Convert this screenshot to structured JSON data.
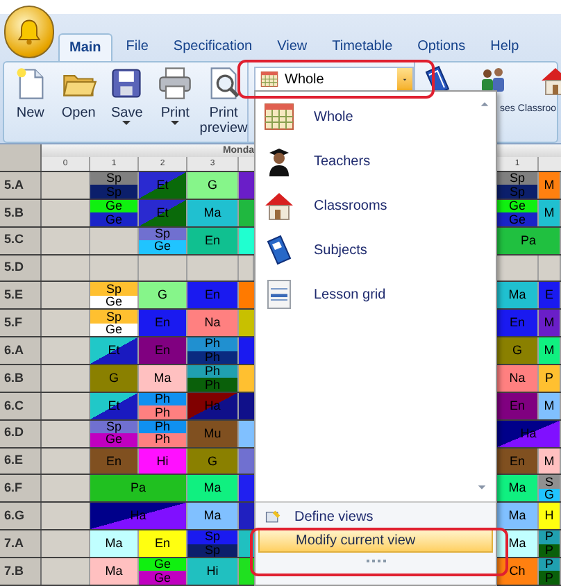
{
  "tabs": [
    {
      "label": "Main",
      "selected": true
    },
    {
      "label": "File",
      "selected": false
    },
    {
      "label": "Specification",
      "selected": false
    },
    {
      "label": "View",
      "selected": false
    },
    {
      "label": "Timetable",
      "selected": false
    },
    {
      "label": "Options",
      "selected": false
    },
    {
      "label": "Help",
      "selected": false
    }
  ],
  "ribbon": {
    "buttons": [
      {
        "label": "New",
        "dropdown": false
      },
      {
        "label": "Open",
        "dropdown": false
      },
      {
        "label": "Save",
        "dropdown": true
      },
      {
        "label": "Print",
        "dropdown": true
      },
      {
        "label": "Print preview",
        "dropdown": false
      }
    ],
    "view_combo": {
      "value": "Whole"
    },
    "partial_labels": [
      "ses",
      "Classroo"
    ]
  },
  "timetable": {
    "day": "Monda",
    "periods": [
      "0",
      "1",
      "2",
      "3"
    ],
    "right_periods": [
      "1"
    ],
    "rows": [
      {
        "class": "5.A",
        "cells": [
          {
            "kind": "split",
            "parts": [
              {
                "text": "Sp",
                "color": "#808080"
              },
              {
                "text": "Sp",
                "color": "#0c1f6b"
              }
            ]
          },
          {
            "kind": "diagonal",
            "parts": [
              {
                "text": "Et",
                "color": "#2a2ad0"
              },
              {
                "color": "#0a6a0a"
              }
            ]
          },
          {
            "kind": "single",
            "parts": [
              {
                "text": "G",
                "color": "#86f58a"
              }
            ]
          },
          {
            "kind": "strip",
            "parts": [
              {
                "color": "#6a1ec8"
              }
            ]
          }
        ],
        "right": [
          {
            "kind": "split",
            "parts": [
              {
                "text": "Sp",
                "color": "#808080"
              },
              {
                "text": "Sp",
                "color": "#0c1f6b"
              }
            ]
          },
          {
            "kind": "single",
            "parts": [
              {
                "text": "M",
                "color": "#ff8010"
              }
            ]
          }
        ]
      },
      {
        "class": "5.B",
        "cells": [
          {
            "kind": "split",
            "parts": [
              {
                "text": "Ge",
                "color": "#10f010"
              },
              {
                "text": "Ge",
                "color": "#1a24c8"
              }
            ]
          },
          {
            "kind": "diagonal",
            "parts": [
              {
                "text": "Et",
                "color": "#2a2ad0"
              },
              {
                "color": "#0a6a0a"
              }
            ]
          },
          {
            "kind": "single",
            "parts": [
              {
                "text": "Ma",
                "color": "#20c0d0"
              }
            ]
          },
          {
            "kind": "strip",
            "parts": [
              {
                "color": "#20b840"
              }
            ]
          }
        ],
        "right": [
          {
            "kind": "split",
            "parts": [
              {
                "text": "Ge",
                "color": "#10f010"
              },
              {
                "text": "Ge",
                "color": "#1a24c8"
              }
            ]
          },
          {
            "kind": "single",
            "parts": [
              {
                "text": "M",
                "color": "#20c0d0"
              }
            ]
          }
        ]
      },
      {
        "class": "5.C",
        "cells": [
          {
            "kind": "empty"
          },
          {
            "kind": "split",
            "parts": [
              {
                "text": "Sp",
                "color": "#7070d0"
              },
              {
                "text": "Ge",
                "color": "#20c4ff"
              }
            ]
          },
          {
            "kind": "single",
            "parts": [
              {
                "text": "En",
                "color": "#10c090"
              }
            ]
          },
          {
            "kind": "strip",
            "parts": [
              {
                "color": "#20ffd0"
              }
            ]
          }
        ],
        "right": [
          {
            "kind": "wide",
            "parts": [
              {
                "text": "Pa",
                "color": "#20c040"
              }
            ]
          }
        ]
      },
      {
        "class": "5.D",
        "cells": [
          {
            "kind": "empty"
          },
          {
            "kind": "empty"
          },
          {
            "kind": "empty"
          },
          {
            "kind": "strip-empty"
          }
        ],
        "right": [
          {
            "kind": "empty"
          },
          {
            "kind": "empty-narrow"
          }
        ]
      },
      {
        "class": "5.E",
        "cells": [
          {
            "kind": "split",
            "parts": [
              {
                "text": "Sp",
                "color": "#ffc030"
              },
              {
                "text": "Ge",
                "color": "#ffffff"
              }
            ]
          },
          {
            "kind": "single",
            "parts": [
              {
                "text": "G",
                "color": "#86f58a"
              }
            ]
          },
          {
            "kind": "single",
            "parts": [
              {
                "text": "En",
                "color": "#1a1af0"
              }
            ]
          },
          {
            "kind": "strip",
            "parts": [
              {
                "color": "#ff7a00"
              }
            ]
          }
        ],
        "right": [
          {
            "kind": "single",
            "parts": [
              {
                "text": "Ma",
                "color": "#20c0d0"
              }
            ]
          },
          {
            "kind": "single",
            "parts": [
              {
                "text": "E",
                "color": "#1a1af0"
              }
            ]
          }
        ]
      },
      {
        "class": "5.F",
        "cells": [
          {
            "kind": "split",
            "parts": [
              {
                "text": "Sp",
                "color": "#ffc030"
              },
              {
                "text": "Ge",
                "color": "#ffffff"
              }
            ]
          },
          {
            "kind": "single",
            "parts": [
              {
                "text": "En",
                "color": "#1a1af0"
              }
            ]
          },
          {
            "kind": "single",
            "parts": [
              {
                "text": "Na",
                "color": "#ff8080"
              }
            ]
          },
          {
            "kind": "strip",
            "parts": [
              {
                "color": "#c8c000"
              }
            ]
          }
        ],
        "right": [
          {
            "kind": "single",
            "parts": [
              {
                "text": "En",
                "color": "#1a1af0"
              }
            ]
          },
          {
            "kind": "single",
            "parts": [
              {
                "text": "M",
                "color": "#6a1ec8"
              }
            ]
          }
        ]
      },
      {
        "class": "6.A",
        "cells": [
          {
            "kind": "diagonal",
            "parts": [
              {
                "text": "Et",
                "color": "#20c8c8"
              },
              {
                "color": "#1a1ac0"
              }
            ]
          },
          {
            "kind": "single",
            "parts": [
              {
                "text": "En",
                "color": "#800080"
              }
            ]
          },
          {
            "kind": "split",
            "parts": [
              {
                "text": "Ph",
                "color": "#2090d0"
              },
              {
                "text": "Ph",
                "color": "#0a2a80"
              }
            ]
          },
          {
            "kind": "strip",
            "parts": [
              {
                "color": "#1a1af0"
              }
            ]
          }
        ],
        "right": [
          {
            "kind": "single",
            "parts": [
              {
                "text": "G",
                "color": "#8a8000"
              }
            ]
          },
          {
            "kind": "single",
            "parts": [
              {
                "text": "M",
                "color": "#10f080"
              }
            ]
          }
        ]
      },
      {
        "class": "6.B",
        "cells": [
          {
            "kind": "single",
            "parts": [
              {
                "text": "G",
                "color": "#8a8000"
              }
            ]
          },
          {
            "kind": "single",
            "parts": [
              {
                "text": "Ma",
                "color": "#ffc0c0"
              }
            ]
          },
          {
            "kind": "split",
            "parts": [
              {
                "text": "Ph",
                "color": "#20a0b0"
              },
              {
                "text": "Ph",
                "color": "#0a600a"
              }
            ]
          },
          {
            "kind": "strip",
            "parts": [
              {
                "color": "#ffc030"
              }
            ]
          }
        ],
        "right": [
          {
            "kind": "single",
            "parts": [
              {
                "text": "Na",
                "color": "#ff8080"
              }
            ]
          },
          {
            "kind": "single",
            "parts": [
              {
                "text": "P",
                "color": "#ffc030"
              }
            ]
          }
        ]
      },
      {
        "class": "6.C",
        "cells": [
          {
            "kind": "diagonal",
            "parts": [
              {
                "text": "Et",
                "color": "#20c8c8"
              },
              {
                "color": "#1a1ac0"
              }
            ]
          },
          {
            "kind": "split",
            "parts": [
              {
                "text": "Ph",
                "color": "#1090f0"
              },
              {
                "text": "Ph",
                "color": "#ff8080"
              }
            ]
          },
          {
            "kind": "diagonal",
            "parts": [
              {
                "text": "Ha",
                "color": "#800000"
              },
              {
                "color": "#10108a"
              }
            ]
          },
          {
            "kind": "strip",
            "parts": [
              {
                "color": "#10108a"
              }
            ]
          }
        ],
        "right": [
          {
            "kind": "single",
            "parts": [
              {
                "text": "En",
                "color": "#800080"
              }
            ]
          },
          {
            "kind": "single",
            "parts": [
              {
                "text": "M",
                "color": "#80c0ff"
              }
            ]
          }
        ]
      },
      {
        "class": "6.D",
        "cells": [
          {
            "kind": "split",
            "parts": [
              {
                "text": "Sp",
                "color": "#7070d0"
              },
              {
                "text": "Ge",
                "color": "#c000c0"
              }
            ]
          },
          {
            "kind": "split",
            "parts": [
              {
                "text": "Ph",
                "color": "#1090f0"
              },
              {
                "text": "Ph",
                "color": "#ff8080"
              }
            ]
          },
          {
            "kind": "single",
            "parts": [
              {
                "text": "Mu",
                "color": "#805020"
              }
            ]
          },
          {
            "kind": "strip",
            "parts": [
              {
                "color": "#80c0ff"
              }
            ]
          }
        ],
        "right": [
          {
            "kind": "wide-diagonal",
            "parts": [
              {
                "text": "Ha",
                "color": "#00008a"
              },
              {
                "color": "#8010ff"
              }
            ]
          }
        ]
      },
      {
        "class": "6.E",
        "cells": [
          {
            "kind": "single",
            "parts": [
              {
                "text": "En",
                "color": "#805020"
              }
            ]
          },
          {
            "kind": "single",
            "parts": [
              {
                "text": "Hi",
                "color": "#ff10ff"
              }
            ]
          },
          {
            "kind": "single",
            "parts": [
              {
                "text": "G",
                "color": "#8a8000"
              }
            ]
          },
          {
            "kind": "strip",
            "parts": [
              {
                "color": "#7070d0"
              }
            ]
          }
        ],
        "right": [
          {
            "kind": "single",
            "parts": [
              {
                "text": "En",
                "color": "#805020"
              }
            ]
          },
          {
            "kind": "single",
            "parts": [
              {
                "text": "M",
                "color": "#ffc0c0"
              }
            ]
          }
        ]
      },
      {
        "class": "6.F",
        "cells": [
          {
            "kind": "wide",
            "parts": [
              {
                "text": "Pa",
                "color": "#20c020"
              }
            ]
          },
          {
            "kind": "single",
            "parts": [
              {
                "text": "Ma",
                "color": "#10f080"
              }
            ]
          },
          {
            "kind": "strip",
            "parts": [
              {
                "color": "#2020f0"
              }
            ]
          }
        ],
        "right": [
          {
            "kind": "single",
            "parts": [
              {
                "text": "Ma",
                "color": "#10f080"
              }
            ]
          },
          {
            "kind": "split",
            "parts": [
              {
                "text": "S",
                "color": "#909090"
              },
              {
                "text": "G",
                "color": "#20c4ff"
              }
            ]
          }
        ]
      },
      {
        "class": "6.G",
        "cells": [
          {
            "kind": "wide-diagonal",
            "parts": [
              {
                "text": "Ha",
                "color": "#00008a"
              },
              {
                "color": "#8010ff"
              }
            ]
          },
          {
            "kind": "single",
            "parts": [
              {
                "text": "Ma",
                "color": "#80c0ff"
              }
            ]
          },
          {
            "kind": "strip",
            "parts": [
              {
                "color": "#2020c0"
              }
            ]
          }
        ],
        "right": [
          {
            "kind": "single",
            "parts": [
              {
                "text": "Ma",
                "color": "#80c0ff"
              }
            ]
          },
          {
            "kind": "single",
            "parts": [
              {
                "text": "H",
                "color": "#ffff10"
              }
            ]
          }
        ]
      },
      {
        "class": "7.A",
        "cells": [
          {
            "kind": "single",
            "parts": [
              {
                "text": "Ma",
                "color": "#c0ffff"
              }
            ]
          },
          {
            "kind": "single",
            "parts": [
              {
                "text": "En",
                "color": "#ffff10"
              }
            ]
          },
          {
            "kind": "split",
            "parts": [
              {
                "text": "Sp",
                "color": "#1a1af0"
              },
              {
                "text": "Sp",
                "color": "#0c1f6b"
              }
            ]
          },
          {
            "kind": "strip",
            "parts": [
              {
                "color": "#20c0c0"
              }
            ]
          }
        ],
        "right": [
          {
            "kind": "single",
            "parts": [
              {
                "text": "Ma",
                "color": "#c0ffff"
              }
            ]
          },
          {
            "kind": "split",
            "parts": [
              {
                "text": "P",
                "color": "#20a0b0"
              },
              {
                "text": "P",
                "color": "#0a600a"
              }
            ]
          }
        ]
      },
      {
        "class": "7.B",
        "cells": [
          {
            "kind": "single",
            "parts": [
              {
                "text": "Ma",
                "color": "#ffc0c0"
              }
            ]
          },
          {
            "kind": "split",
            "parts": [
              {
                "text": "Ge",
                "color": "#10f010"
              },
              {
                "text": "Ge",
                "color": "#c000c0"
              }
            ]
          },
          {
            "kind": "single",
            "parts": [
              {
                "text": "Hi",
                "color": "#20c0c0"
              }
            ]
          },
          {
            "kind": "strip",
            "parts": [
              {
                "color": "#20e020"
              }
            ]
          }
        ],
        "right": [
          {
            "kind": "single",
            "parts": [
              {
                "text": "Ch",
                "color": "#ff8010"
              }
            ]
          },
          {
            "kind": "split",
            "parts": [
              {
                "text": "P",
                "color": "#20a0b0"
              },
              {
                "text": "P",
                "color": "#0a600a"
              }
            ]
          }
        ]
      }
    ]
  },
  "view_menu": {
    "items": [
      {
        "label": "Whole",
        "selected": false
      },
      {
        "label": "Teachers",
        "selected": false
      },
      {
        "label": "Classrooms",
        "selected": false
      },
      {
        "label": "Subjects",
        "selected": false
      },
      {
        "label": "Lesson grid",
        "selected": false
      }
    ],
    "footer_items": [
      {
        "label": "Define views",
        "selected": false
      },
      {
        "label": "Modify current view",
        "selected": true
      }
    ]
  }
}
